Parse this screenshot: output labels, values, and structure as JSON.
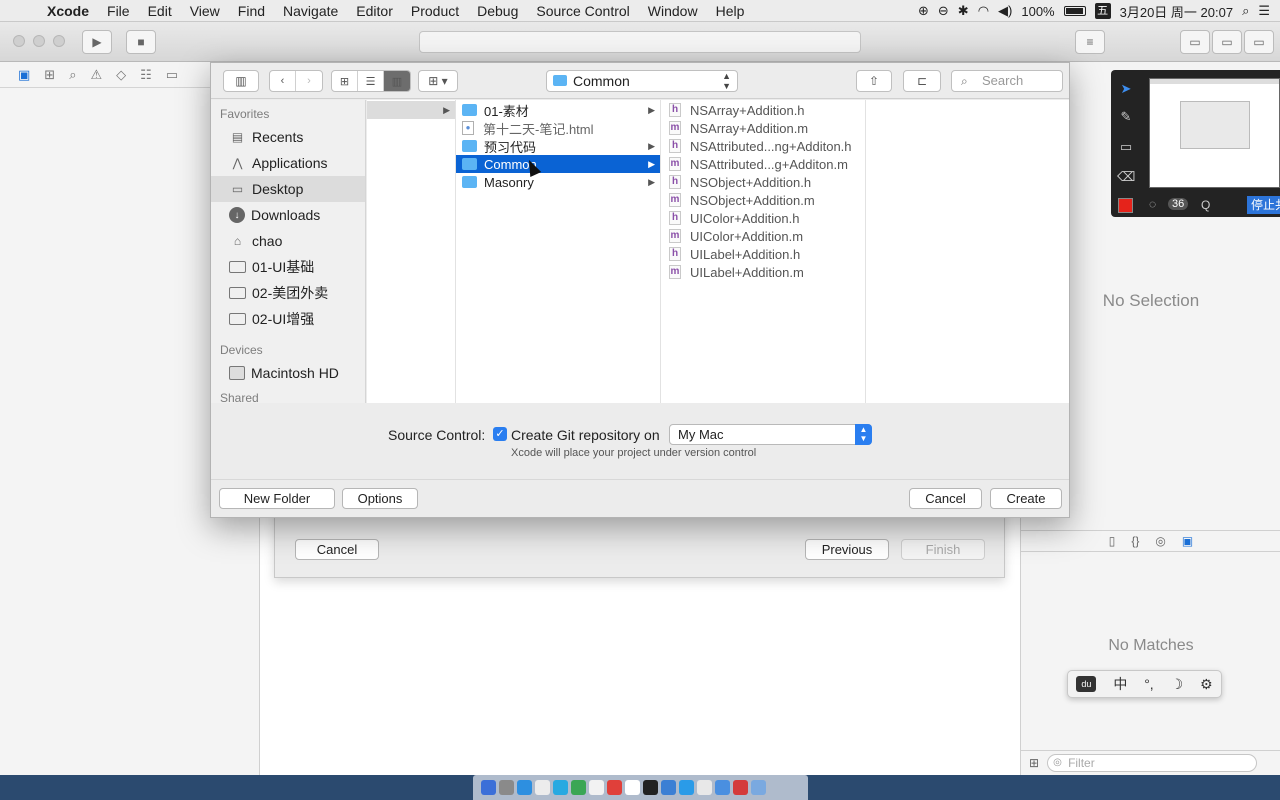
{
  "menubar": {
    "apple": "",
    "items": [
      "Xcode",
      "File",
      "Edit",
      "View",
      "Find",
      "Navigate",
      "Editor",
      "Product",
      "Debug",
      "Source Control",
      "Window",
      "Help"
    ],
    "battery": "100%",
    "ime": "五",
    "datetime": "3月20日 周一 20:07"
  },
  "panel": {
    "location": "Common",
    "search_placeholder": "Search",
    "sidebar": {
      "favorites_label": "Favorites",
      "favorites": [
        "Recents",
        "Applications",
        "Desktop",
        "Downloads",
        "chao",
        "01-UI基础",
        "02-美团外卖",
        "02-UI增强"
      ],
      "devices_label": "Devices",
      "devices": [
        "Macintosh HD"
      ],
      "shared_label": "Shared"
    },
    "column2": [
      "01-素材",
      "第十二天-笔记.html",
      "预习代码",
      "Common",
      "Masonry"
    ],
    "column3": [
      {
        "type": "h",
        "name": "NSArray+Addition.h"
      },
      {
        "type": "m",
        "name": "NSArray+Addition.m"
      },
      {
        "type": "h",
        "name": "NSAttributed...ng+Additon.h"
      },
      {
        "type": "m",
        "name": "NSAttributed...g+Additon.m"
      },
      {
        "type": "h",
        "name": "NSObject+Addition.h"
      },
      {
        "type": "m",
        "name": "NSObject+Addition.m"
      },
      {
        "type": "h",
        "name": "UIColor+Addition.h"
      },
      {
        "type": "m",
        "name": "UIColor+Addition.m"
      },
      {
        "type": "h",
        "name": "UILabel+Addition.h"
      },
      {
        "type": "m",
        "name": "UILabel+Addition.m"
      }
    ],
    "source_control": {
      "label": "Source Control:",
      "checkbox_label": "Create Git repository on",
      "target": "My Mac",
      "note": "Xcode will place your project under version control"
    },
    "buttons": {
      "new_folder": "New Folder",
      "options": "Options",
      "cancel": "Cancel",
      "create": "Create"
    }
  },
  "sheet": {
    "cancel": "Cancel",
    "previous": "Previous",
    "finish": "Finish"
  },
  "inspector": {
    "no_selection": "No Selection",
    "no_matches": "No Matches",
    "filter_placeholder": "Filter"
  },
  "annotation": {
    "count": "36",
    "stop_label": "停止共享"
  },
  "ime_bar": {
    "items": [
      "du",
      "中",
      "°,",
      "☽",
      "⚙"
    ]
  }
}
